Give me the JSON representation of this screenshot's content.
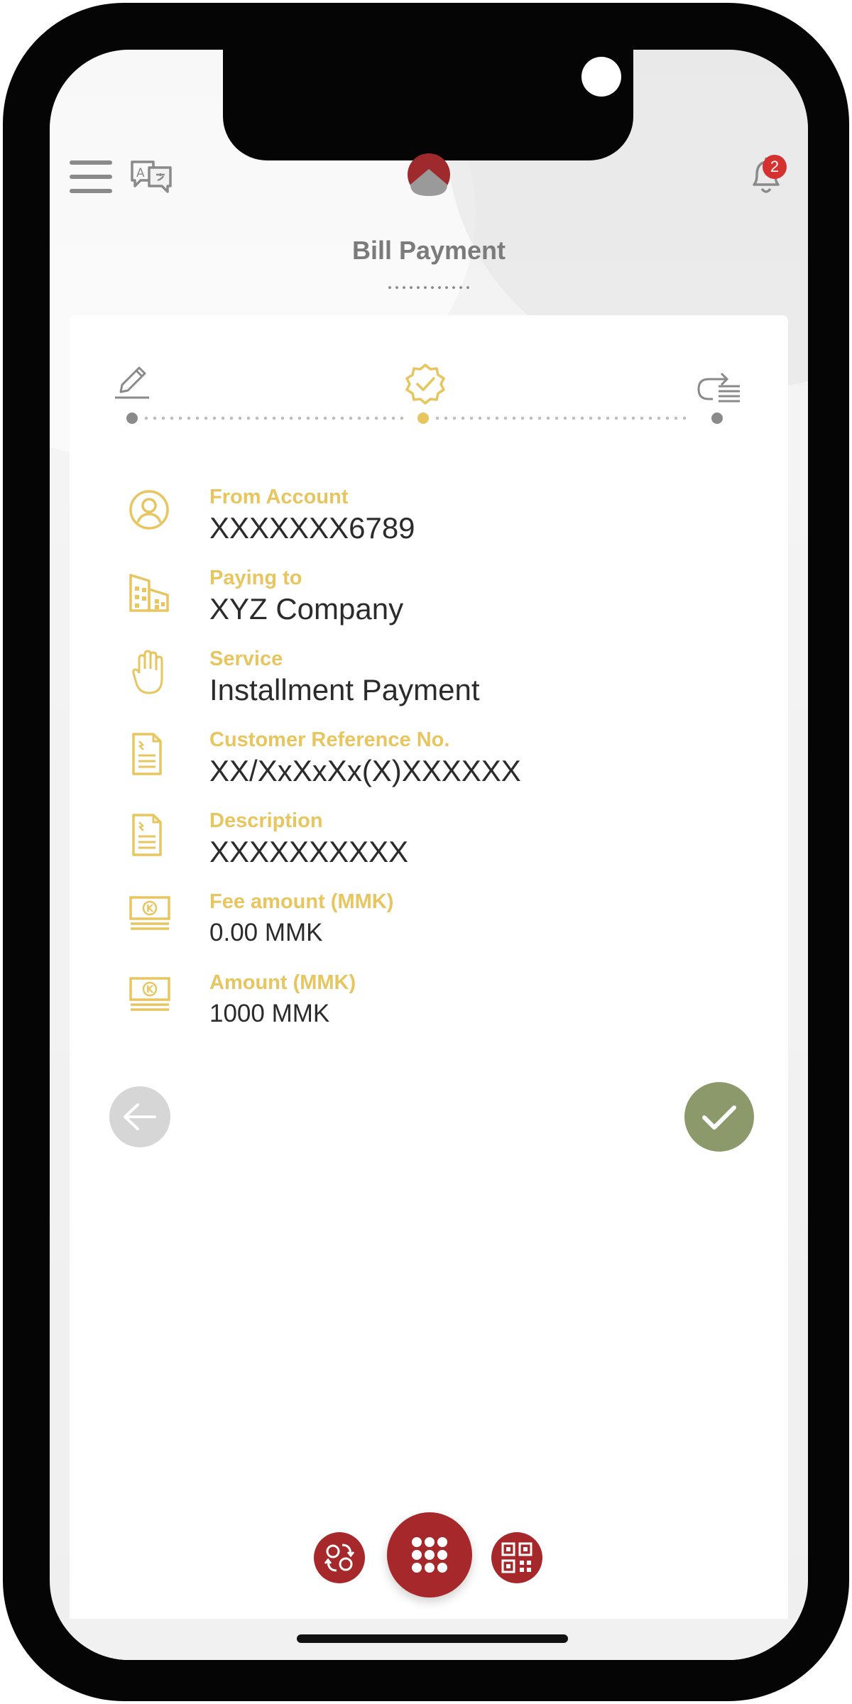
{
  "header": {
    "title": "Bill Payment",
    "notification_count": "2",
    "menu_icon": "hamburger-menu-icon",
    "language_icon": "translate-icon",
    "logo_icon": "bank-logo-icon",
    "bell_icon": "bell-icon"
  },
  "steps": [
    {
      "icon": "pencil-edit-icon",
      "state": "done"
    },
    {
      "icon": "verified-badge-icon",
      "state": "current"
    },
    {
      "icon": "redo-list-icon",
      "state": "pending"
    }
  ],
  "fields": [
    {
      "label": "From Account",
      "value": "XXXXXXX6789",
      "icon": "user-circle-icon"
    },
    {
      "label": "Paying to",
      "value": "XYZ Company",
      "icon": "buildings-icon"
    },
    {
      "label": "Service",
      "value": "Installment Payment",
      "icon": "hand-icon"
    },
    {
      "label": "Customer Reference No.",
      "value": "XX/XxXxXx(X)XXXXXX",
      "icon": "document-icon"
    },
    {
      "label": "Description",
      "value": "XXXXXXXXXX",
      "icon": "document-icon"
    },
    {
      "label": "Fee amount (MMK)",
      "value": "0.00 MMK",
      "icon": "kyat-banknote-icon"
    },
    {
      "label": "Amount (MMK)",
      "value": "1000 MMK",
      "icon": "kyat-banknote-icon"
    }
  ],
  "actions": {
    "back_icon": "arrow-left-icon",
    "confirm_icon": "checkmark-icon"
  },
  "dock": {
    "left_icon": "transfer-icon",
    "center_icon": "grid-menu-icon",
    "right_icon": "qr-code-icon"
  },
  "colors": {
    "accent_gold": "#e7c55f",
    "brand_red": "#a6282b",
    "confirm_green": "#8c9a6b",
    "badge_red": "#d63131"
  }
}
